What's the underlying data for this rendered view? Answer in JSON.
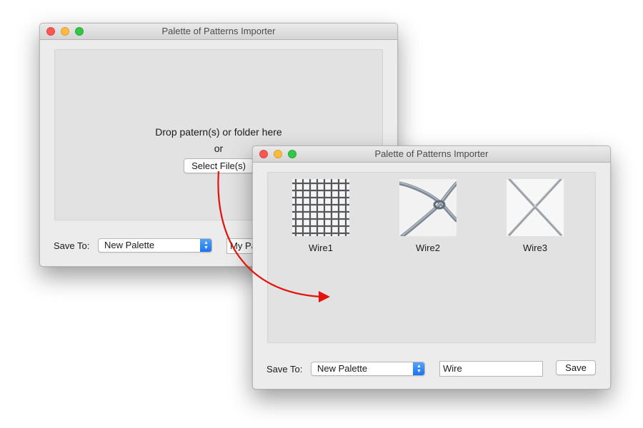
{
  "back_window": {
    "title": "Palette of Patterns Importer",
    "drop_text": "Drop patern(s) or folder here",
    "or_text": "or",
    "select_button": "Select File(s)",
    "save_to_label": "Save To:",
    "palette_popup": "New Palette",
    "name_field": "My Pa"
  },
  "front_window": {
    "title": "Palette of Patterns Importer",
    "patterns": [
      {
        "name": "Wire1",
        "icon": "wire-mesh-grid"
      },
      {
        "name": "Wire2",
        "icon": "chain-link-knot"
      },
      {
        "name": "Wire3",
        "icon": "crossed-wires"
      }
    ],
    "save_to_label": "Save To:",
    "palette_popup": "New Palette",
    "name_field": "Wire",
    "save_button": "Save"
  },
  "annotation": {
    "arrow_color": "#e3120b"
  },
  "colors": {
    "popup_accent": "#1a6ff0",
    "close": "#fc5753",
    "minimize": "#fdbc40",
    "maximize": "#33c748"
  }
}
